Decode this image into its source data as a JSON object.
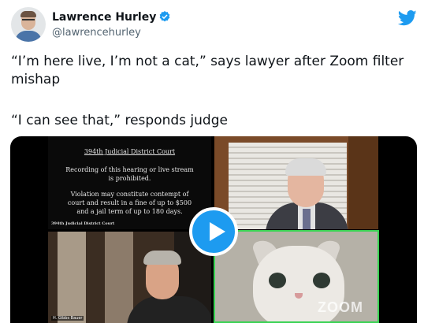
{
  "tweet": {
    "author_name": "Lawrence Hurley",
    "author_handle": "@lawrencehurley",
    "line1": "“I’m here live, I’m not a cat,” says lawyer after Zoom filter",
    "line2": "mishap",
    "line3": "“I can see that,” responds judge"
  },
  "video": {
    "court_title": "394th Judicial District Court",
    "notice_line1": "Recording of this hearing or live stream",
    "notice_line2": "is prohibited.",
    "warning_line1": "Violation may constitute contempt of",
    "warning_line2": "court and result in a fine of up to $500",
    "warning_line3": "and a jail term of up to 180 days.",
    "court_small_label": "394th Judicial District Court",
    "lawyer_caption": "H. Gibbs Bauer",
    "watermark": "ZOOM"
  },
  "icons": {
    "verified": "verified-badge-icon",
    "brand": "twitter-bird-icon",
    "play": "play-icon"
  },
  "colors": {
    "twitter_blue": "#1d9bf0",
    "text": "#0f1419",
    "secondary": "#536471",
    "active_speaker_border": "#39d353"
  }
}
